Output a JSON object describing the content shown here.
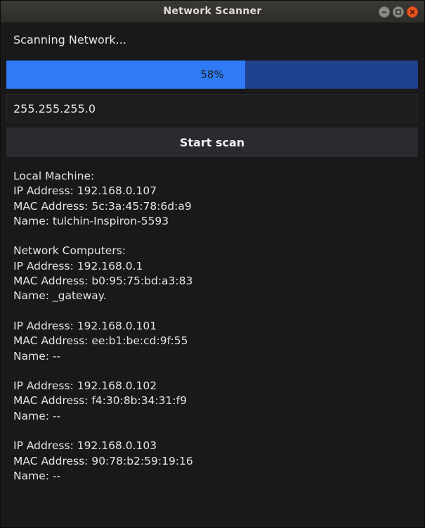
{
  "window": {
    "title": "Network Scanner"
  },
  "status_text": "Scanning Network...",
  "progress": {
    "percent": 58,
    "label": "58%",
    "fill_color": "#2f7bf6",
    "track_color": "#20418e"
  },
  "subnet_mask": {
    "value": "255.255.255.0"
  },
  "scan_button": {
    "label": "Start scan"
  },
  "local_machine": {
    "heading": "Local Machine:",
    "ip": "IP Address: 192.168.0.107",
    "mac": "MAC Address: 5c:3a:45:78:6d:a9",
    "name": "Name: tulchin-Inspiron-5593"
  },
  "network": {
    "heading": "Network Computers:",
    "computers": [
      {
        "ip": "IP Address: 192.168.0.1",
        "mac": "MAC Address: b0:95:75:bd:a3:83",
        "name": "Name: _gateway."
      },
      {
        "ip": "IP Address: 192.168.0.101",
        "mac": "MAC Address: ee:b1:be:cd:9f:55",
        "name": "Name: --"
      },
      {
        "ip": "IP Address: 192.168.0.102",
        "mac": "MAC Address: f4:30:8b:34:31:f9",
        "name": "Name: --"
      },
      {
        "ip": "IP Address: 192.168.0.103",
        "mac": "MAC Address: 90:78:b2:59:19:16",
        "name": "Name: --"
      }
    ]
  }
}
